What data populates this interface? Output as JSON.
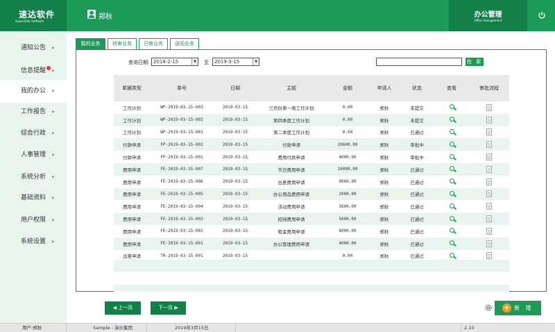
{
  "header": {
    "app_name": "速达软件",
    "app_name_en": "Superstate Software",
    "user_name": "郑秋",
    "module_title": "办公管理",
    "module_title_en": "Office management"
  },
  "sidebar": {
    "items": [
      {
        "label": "通知公告"
      },
      {
        "label": "信息提醒"
      },
      {
        "label": "我的办公"
      },
      {
        "label": "工作报告"
      },
      {
        "label": "综合行政"
      },
      {
        "label": "人事管理"
      },
      {
        "label": "系统分析"
      },
      {
        "label": "基础资料"
      },
      {
        "label": "用户权限"
      },
      {
        "label": "系统设置"
      }
    ],
    "arrow_glyph": "▶"
  },
  "tabs": [
    {
      "label": "我的业务"
    },
    {
      "label": "待审业务"
    },
    {
      "label": "已审业务"
    },
    {
      "label": "送阅业务"
    }
  ],
  "search": {
    "date_label": "查询日期:",
    "start_date": "2018-2-15",
    "to_label": "至",
    "end_date": "2019-3-15",
    "keyword": "",
    "button_label": "检 索"
  },
  "table": {
    "columns": [
      "单据类型",
      "单号",
      "日期",
      "主题",
      "金额",
      "申请人",
      "状态",
      "查看",
      "审批流程"
    ],
    "rows": [
      [
        "工作计划",
        "WP-2019-03-15-003",
        "2019-03-15",
        "三月份第一周工作计划",
        "0.00",
        "郑秋",
        "未提交"
      ],
      [
        "工作计划",
        "WP-2019-03-15-002",
        "2019-03-15",
        "第四季度工作计划",
        "0.00",
        "郑秋",
        "未提交"
      ],
      [
        "工作计划",
        "WP-2019-03-15-001",
        "2019-03-15",
        "第二季度工作计划",
        "0.00",
        "郑秋",
        "已通过"
      ],
      [
        "付款申请",
        "FP-2019-03-15-002",
        "2019-03-15",
        "付款申请",
        "20600.00",
        "郑秋",
        "审批中"
      ],
      [
        "付款申请",
        "FP-2019-03-15-001",
        "2019-03-15",
        "费用付款申请",
        "4000.00",
        "郑秋",
        "审批中"
      ],
      [
        "费用申请",
        "FE-2019-03-15-007",
        "2019-03-15",
        "节日费用申请",
        "10000.00",
        "郑秋",
        "已通过"
      ],
      [
        "费用申请",
        "FE-2019-03-15-006",
        "2019-03-15",
        "出差费用申请",
        "9000.00",
        "郑秋",
        "已通过"
      ],
      [
        "费用申请",
        "FE-2019-03-15-005",
        "2019-03-15",
        "办公用品费用申请",
        "2000.00",
        "郑秋",
        "已通过"
      ],
      [
        "费用申请",
        "FE-2019-03-15-004",
        "2019-03-15",
        "活动费用申请",
        "3600.00",
        "郑秋",
        "已通过"
      ],
      [
        "费用申请",
        "FE-2019-03-15-003",
        "2019-03-15",
        "招待费用申请",
        "5000.00",
        "郑秋",
        "已通过"
      ],
      [
        "费用申请",
        "FE-2019-03-15-002",
        "2019-03-15",
        "租金费用申请",
        "8000.00",
        "郑秋",
        "已通过"
      ],
      [
        "费用申请",
        "FE-2019-03-15-001",
        "2019-03-15",
        "办公管理费用申请",
        "4000.00",
        "郑秋",
        "已通过"
      ],
      [
        "出差申请",
        "TR-2019-03-15-001",
        "2019-03-15",
        "",
        "0.00",
        "郑秋",
        "已通过"
      ]
    ]
  },
  "pager": {
    "prev_label": "◀ 上一页",
    "next_label": "下一页 ▶"
  },
  "actions": {
    "add_label": "新 增",
    "add_glyph": "+"
  },
  "statusbar": {
    "user": "用户:郑秋",
    "company": "Sample - 演示集团",
    "date": "2019年3月15日",
    "version": "2.10"
  },
  "colors": {
    "primary": "#1b9a58",
    "primary_dark": "#13804a",
    "row_alt": "#e9f4ee",
    "accent": "#f49a1a"
  }
}
